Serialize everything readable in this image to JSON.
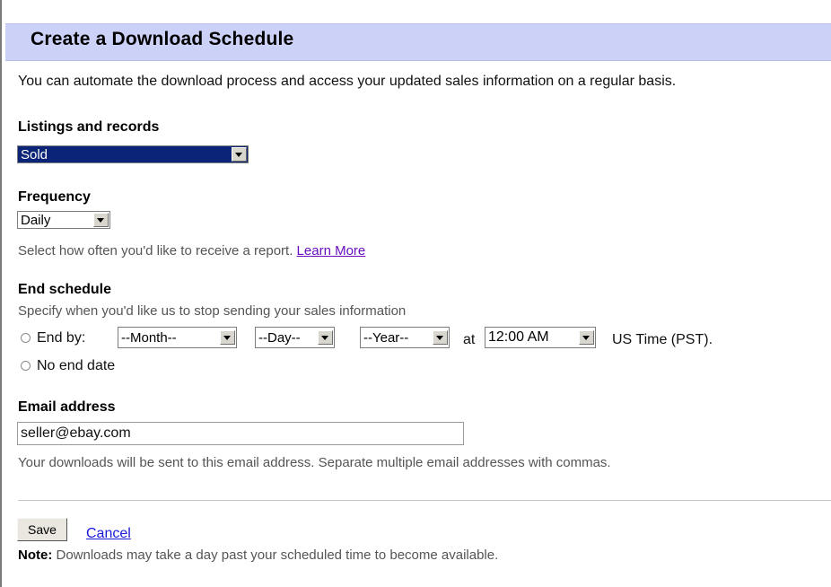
{
  "title": "Create a Download Schedule",
  "intro": "You can automate the download process and access your updated sales information on a regular basis.",
  "listings": {
    "label": "Listings and records",
    "selected": "Sold"
  },
  "frequency": {
    "label": "Frequency",
    "selected": "Daily",
    "help": "Select how often you'd like to receive a report.",
    "learn_more": "Learn More"
  },
  "end_schedule": {
    "label": "End schedule",
    "help": "Specify when you'd like us to stop sending your sales information",
    "end_by_label": "End by:",
    "month": "--Month--",
    "day": "--Day--",
    "year": "--Year--",
    "at": "at",
    "time": "12:00 AM",
    "timezone": "US Time (PST).",
    "no_end_label": "No end date"
  },
  "email": {
    "label": "Email address",
    "value": "seller@ebay.com",
    "help": "Your downloads will be sent to this email address. Separate multiple email addresses with commas."
  },
  "actions": {
    "save": "Save",
    "cancel": "Cancel"
  },
  "note": {
    "prefix": "Note:",
    "text": " Downloads may take a day past your scheduled time to become available."
  },
  "colors": {
    "header_bg": "#ccd1f7",
    "selected_bg": "#0b2477",
    "link": "#1a1ad8",
    "visited_link": "#6a0fbf"
  }
}
